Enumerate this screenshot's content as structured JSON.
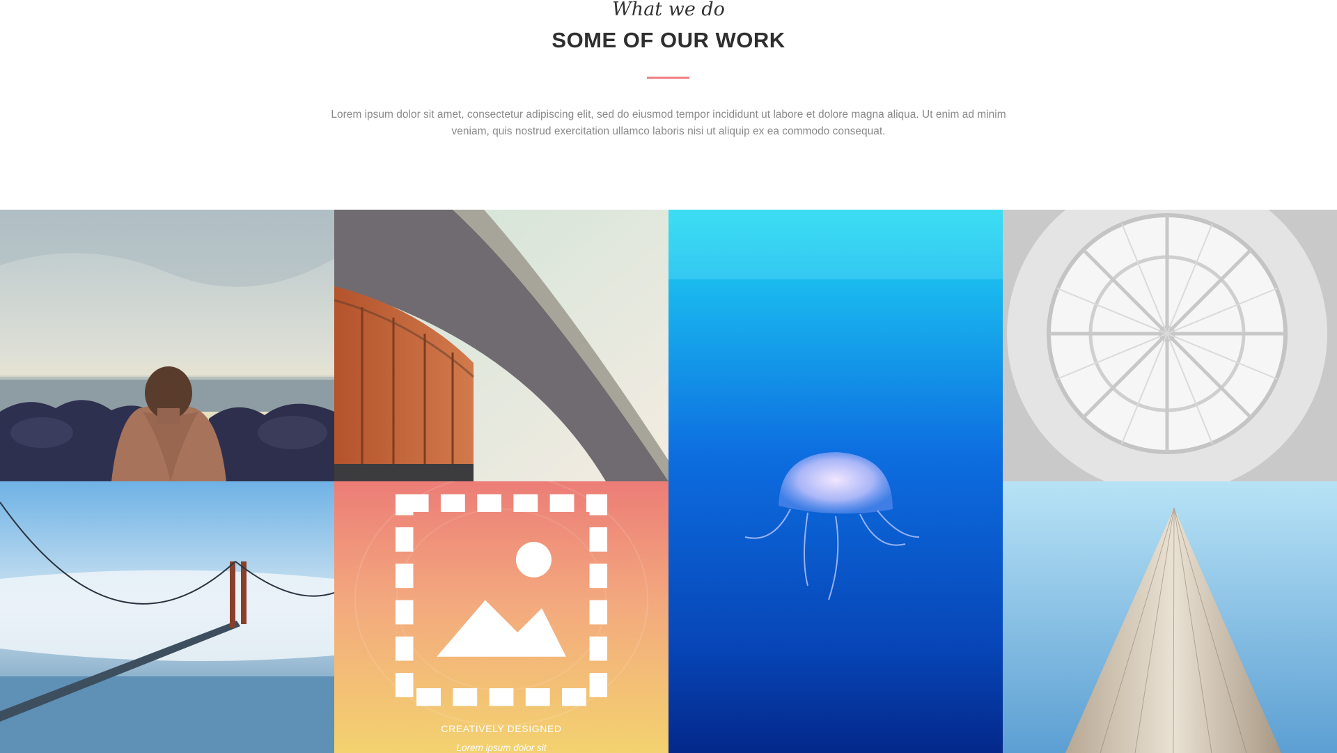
{
  "section": {
    "eyebrow": "What we do",
    "title": "SOME OF OUR WORK",
    "intro": "Lorem ipsum dolor sit amet, consectetur adipiscing elit, sed do eiusmod tempor incididunt ut labore et dolore magna aliqua. Ut enim ad minim veniam, quis nostrud exercitation ullamco laboris nisi ut aliquip ex ea commodo consequat.",
    "accent_color": "#f07f86"
  },
  "portfolio": {
    "items": [
      {
        "scene": "man-on-rocky-shore"
      },
      {
        "scene": "curved-architecture"
      },
      {
        "scene": "jellyfish-underwater"
      },
      {
        "scene": "glass-dome-ceiling"
      },
      {
        "scene": "bridge-over-fog"
      },
      {
        "scene": "creatively-designed-overlay",
        "icon": "image-icon",
        "title": "CREATIVELY DESIGNED",
        "subtitle": "Lorem ipsum dolor sit"
      },
      {
        "scene": "skyscraper-from-below"
      }
    ],
    "overlay_gradient": [
      "#ec7d77",
      "#f3a97e",
      "#f3d26f"
    ]
  }
}
